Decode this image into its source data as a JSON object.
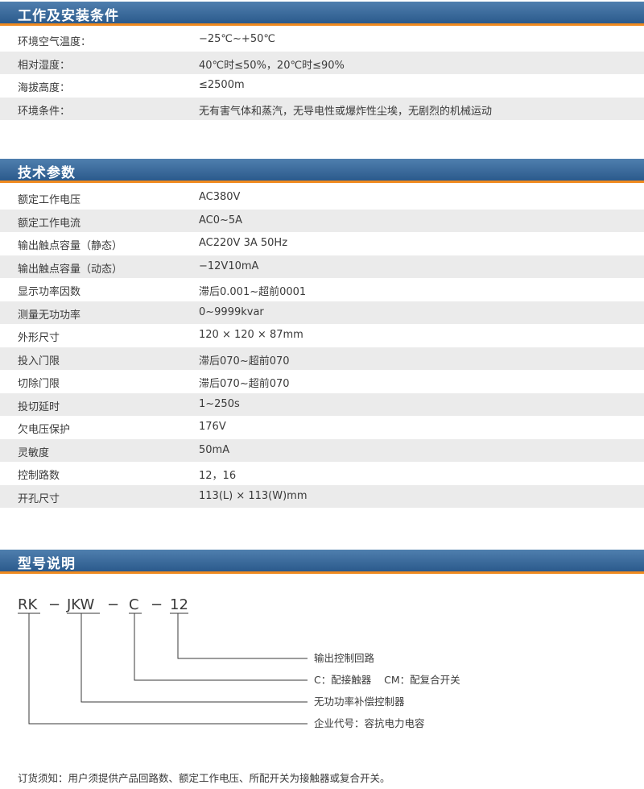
{
  "sections": {
    "env": {
      "title": "工作及安装条件",
      "rows": [
        {
          "label": "环境空气温度：",
          "value": "−25℃~+50℃"
        },
        {
          "label": "相对湿度：",
          "value": "40℃时≤50%，20℃时≤90%"
        },
        {
          "label": "海拔高度：",
          "value": "≤2500m"
        },
        {
          "label": "环境条件：",
          "value": "无有害气体和蒸汽，无导电性或爆炸性尘埃，无剧烈的机械运动"
        }
      ]
    },
    "tech": {
      "title": "技术参数",
      "rows": [
        {
          "label": "额定工作电压",
          "value": "AC380V"
        },
        {
          "label": "额定工作电流",
          "value": "AC0~5A"
        },
        {
          "label": "输出触点容量（静态）",
          "value": "AC220V  3A 50Hz"
        },
        {
          "label": "输出触点容量（动态）",
          "value": "−12V10mA"
        },
        {
          "label": "显示功率因数",
          "value": "滞后0.001~超前0001"
        },
        {
          "label": "测量无功功率",
          "value": "0~9999kvar"
        },
        {
          "label": "外形尺寸",
          "value": "120 × 120 × 87mm"
        },
        {
          "label": "投入门限",
          "value": "滞后070~超前070"
        },
        {
          "label": "切除门限",
          "value": "滞后070~超前070"
        },
        {
          "label": "投切延时",
          "value": "1~250s"
        },
        {
          "label": "欠电压保护",
          "value": "176V"
        },
        {
          "label": "灵敏度",
          "value": "50mA"
        },
        {
          "label": "控制路数",
          "value": "12，16"
        },
        {
          "label": "开孔尺寸",
          "value": "113(L) × 113(W)mm"
        }
      ]
    },
    "model": {
      "title": "型号说明",
      "code_parts": [
        "RK",
        "JKW",
        "C",
        "12"
      ],
      "separator": "−",
      "annotations": [
        "输出控制回路",
        "C：配接触器    CM：配复合开关",
        "无功功率补偿控制器",
        "企业代号：容抗电力电容"
      ]
    }
  },
  "footnote": "订货须知：用户须提供产品回路数、额定工作电压、所配开关为接触器或复合开关。",
  "colors": {
    "header_blue": "#2b5a8c",
    "header_accent_orange": "#ef8a1f",
    "row_stripe": "#ebebeb"
  }
}
